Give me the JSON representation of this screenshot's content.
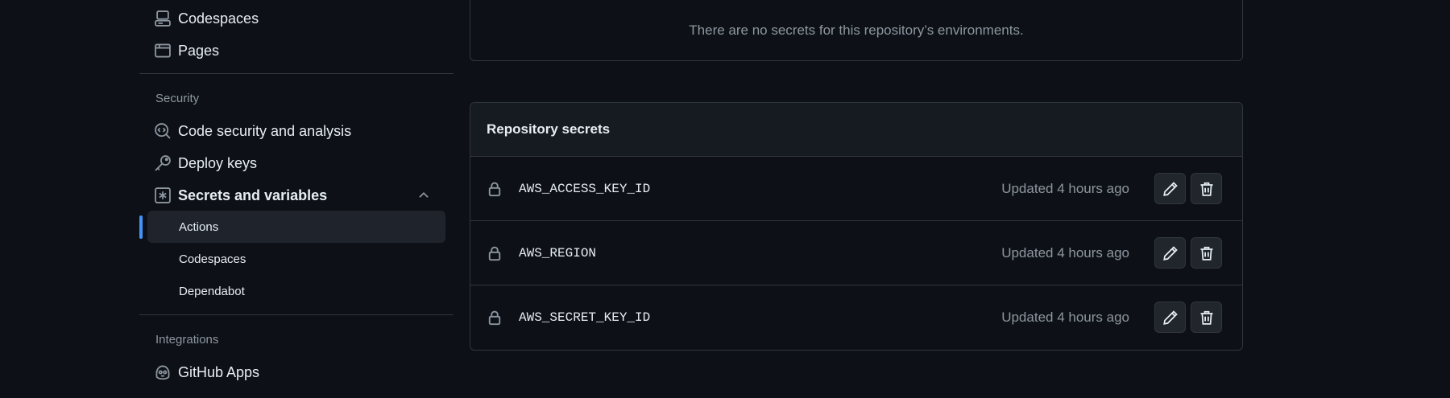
{
  "sidebar": {
    "items_top": [
      {
        "label": "Codespaces",
        "icon": "codespaces-icon"
      },
      {
        "label": "Pages",
        "icon": "browser-icon"
      }
    ],
    "security_heading": "Security",
    "security_items": [
      {
        "label": "Code security and analysis",
        "icon": "codescan-icon"
      },
      {
        "label": "Deploy keys",
        "icon": "key-icon"
      },
      {
        "label": "Secrets and variables",
        "icon": "asterisk-icon"
      }
    ],
    "secrets_sub": [
      {
        "label": "Actions"
      },
      {
        "label": "Codespaces"
      },
      {
        "label": "Dependabot"
      }
    ],
    "integrations_heading": "Integrations",
    "integrations_items": [
      {
        "label": "GitHub Apps",
        "icon": "copilot-icon"
      }
    ]
  },
  "environments": {
    "empty_text": "There are no secrets for this repository’s environments."
  },
  "repository_secrets": {
    "title": "Repository secrets",
    "rows": [
      {
        "name": "AWS_ACCESS_KEY_ID",
        "updated": "Updated 4 hours ago"
      },
      {
        "name": "AWS_REGION",
        "updated": "Updated 4 hours ago"
      },
      {
        "name": "AWS_SECRET_KEY_ID",
        "updated": "Updated 4 hours ago"
      }
    ]
  },
  "colors": {
    "background": "#0d1117",
    "accent": "#4493f8",
    "border": "#30363d",
    "muted_text": "#8d96a0"
  }
}
